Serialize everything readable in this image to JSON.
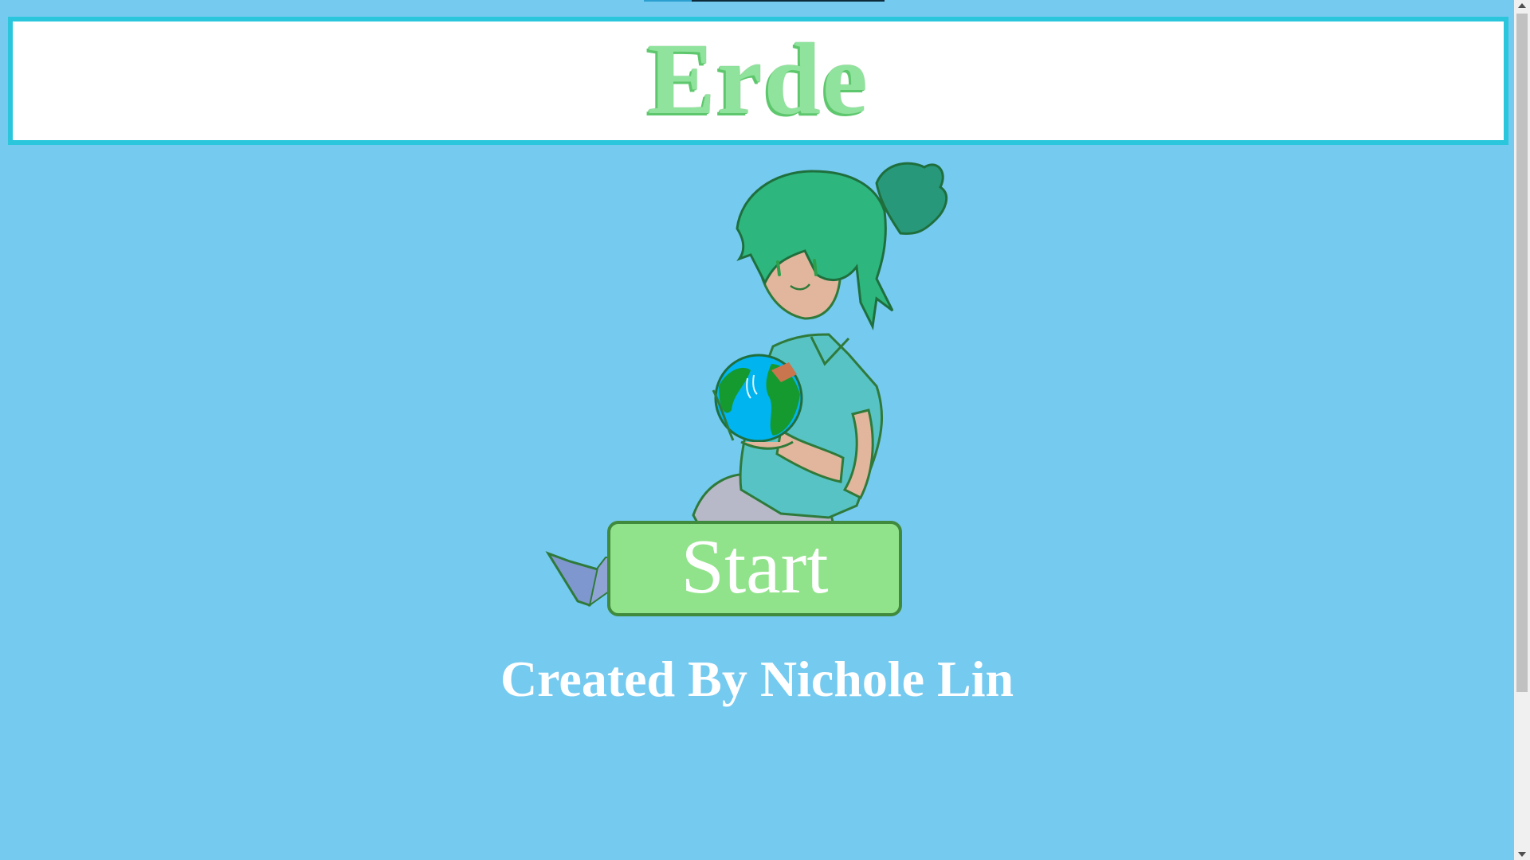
{
  "header": {
    "title": "Erde"
  },
  "illustration": {
    "icon": "girl-holding-earth-illustration"
  },
  "actions": {
    "start_label": "Start"
  },
  "footer": {
    "credit": "Created By Nichole Lin"
  },
  "colors": {
    "background": "#75caf0",
    "title_border": "#29c6dc",
    "title_text": "#8fe39c",
    "button_fill": "#90e38a",
    "button_border": "#3f8a3c"
  }
}
